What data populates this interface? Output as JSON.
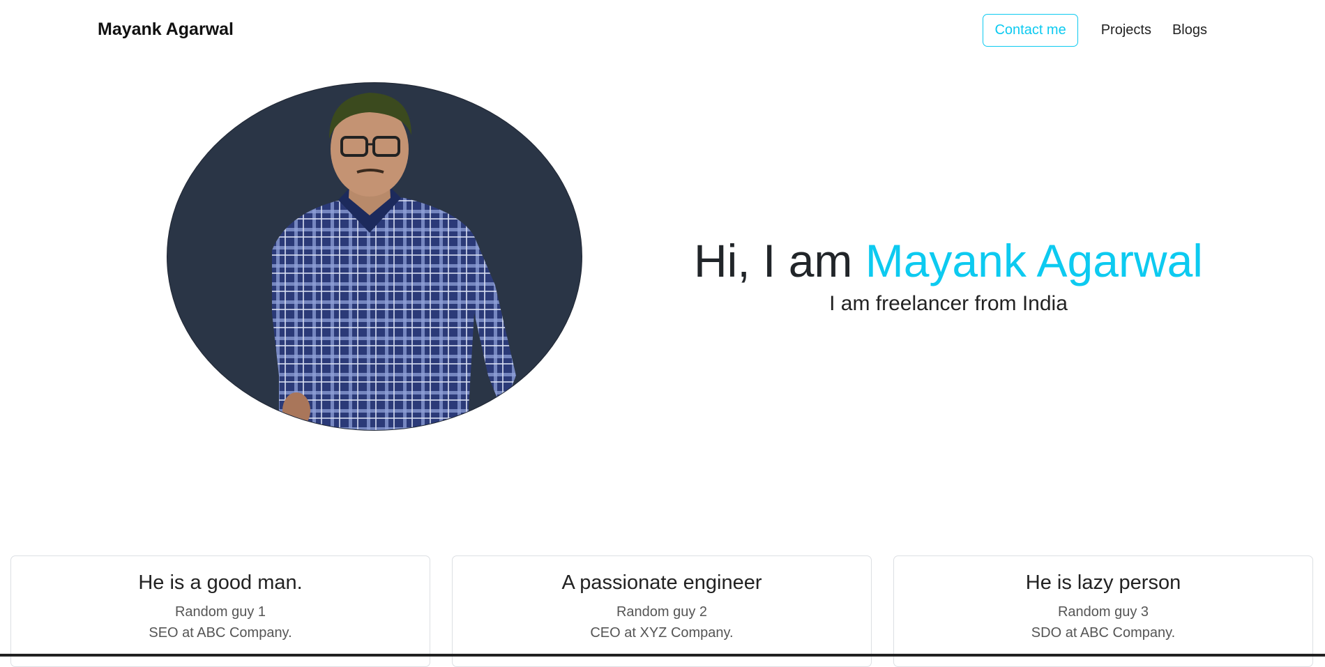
{
  "navbar": {
    "brand": "Mayank Agarwal",
    "contact_label": "Contact me",
    "links": [
      "Projects",
      "Blogs"
    ]
  },
  "hero": {
    "greeting": "Hi, I am ",
    "name": "Mayank Agarwal",
    "subtitle": "I am freelancer from India"
  },
  "cards": [
    {
      "title": "He is a good man.",
      "author": "Random guy 1",
      "role": "SEO at ABC Company."
    },
    {
      "title": "A passionate engineer",
      "author": "Random guy 2",
      "role": "CEO at XYZ Company."
    },
    {
      "title": "He is lazy person",
      "author": "Random guy 3",
      "role": "SDO at ABC Company."
    }
  ],
  "colors": {
    "accent": "#0dcaf0",
    "photo_background": "#2a3546"
  }
}
